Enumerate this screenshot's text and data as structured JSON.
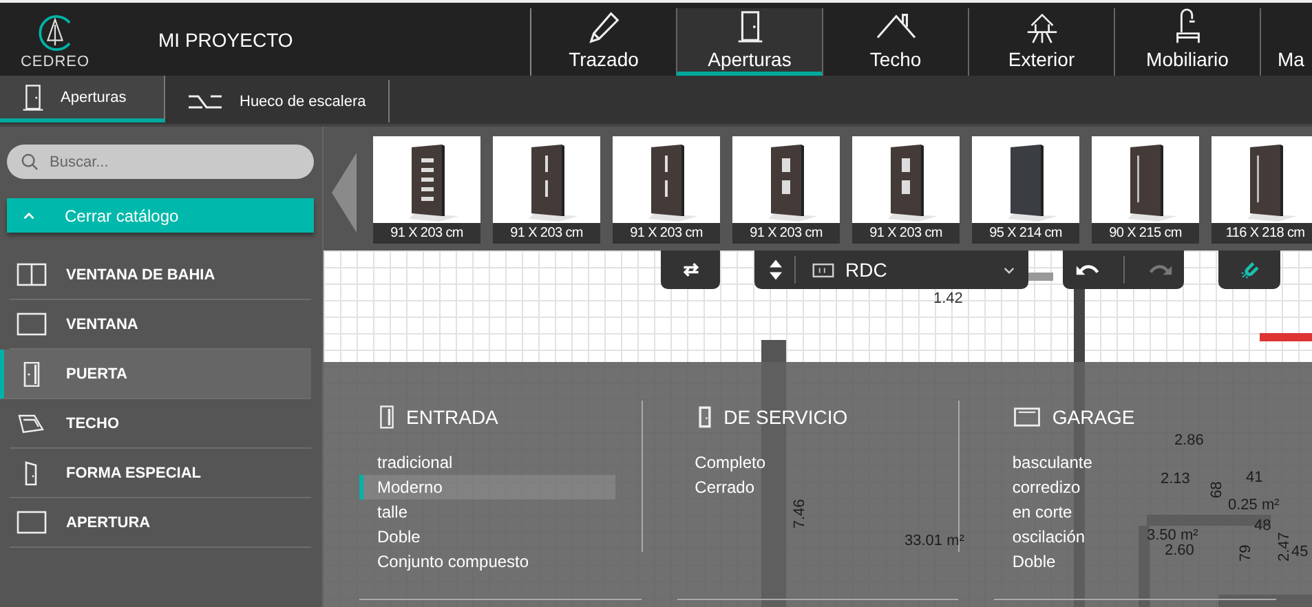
{
  "header": {
    "logo": "CEDREO",
    "project": "MI PROYECTO",
    "tabs": [
      {
        "label": "Trazado",
        "selected": false
      },
      {
        "label": "Aperturas",
        "selected": true
      },
      {
        "label": "Techo",
        "selected": false
      },
      {
        "label": "Exterior",
        "selected": false
      },
      {
        "label": "Mobiliario",
        "selected": false
      },
      {
        "label": "Ma",
        "selected": false
      }
    ]
  },
  "subtabs": [
    {
      "label": "Aperturas",
      "selected": true
    },
    {
      "label": "Hueco de escalera",
      "selected": false
    }
  ],
  "sidebar": {
    "search": {
      "placeholder": "Buscar..."
    },
    "catalog_button": "Cerrar catálogo",
    "items": [
      {
        "label": "VENTANA DE BAHIA",
        "selected": false
      },
      {
        "label": "VENTANA",
        "selected": false
      },
      {
        "label": "PUERTA",
        "selected": true
      },
      {
        "label": "TECHO",
        "selected": false
      },
      {
        "label": "FORMA ESPECIAL",
        "selected": false
      },
      {
        "label": "APERTURA",
        "selected": false
      }
    ]
  },
  "catalog": [
    {
      "size": "91 X 203 cm"
    },
    {
      "size": "91 X 203 cm"
    },
    {
      "size": "91 X 203 cm"
    },
    {
      "size": "91 X 203 cm"
    },
    {
      "size": "91 X 203 cm"
    },
    {
      "size": "95 X 214 cm"
    },
    {
      "size": "90 X 215 cm"
    },
    {
      "size": "116 X 218 cm"
    }
  ],
  "toolbar": {
    "level": "RDC"
  },
  "plan": {
    "labels": [
      "1.42",
      "7.46",
      "33.01 m²",
      "2.86",
      "2.13",
      "41",
      "68",
      "0.25 m²",
      "48",
      "3.50 m²",
      "79",
      "2.60",
      "2.47",
      "45"
    ]
  },
  "menu": {
    "columns": [
      {
        "title": "ENTRADA",
        "items": [
          {
            "label": "tradicional",
            "selected": false
          },
          {
            "label": "Moderno",
            "selected": true
          },
          {
            "label": "talle",
            "selected": false
          },
          {
            "label": "Doble",
            "selected": false
          },
          {
            "label": "Conjunto compuesto",
            "selected": false
          }
        ]
      },
      {
        "title": "DE SERVICIO",
        "items": [
          {
            "label": "Completo",
            "selected": false
          },
          {
            "label": "Cerrado",
            "selected": false
          }
        ]
      },
      {
        "title": "GARAGE",
        "items": [
          {
            "label": "basculante",
            "selected": false
          },
          {
            "label": "corredizo",
            "selected": false
          },
          {
            "label": "en corte",
            "selected": false
          },
          {
            "label": "oscilación",
            "selected": false
          },
          {
            "label": "Doble",
            "selected": false
          }
        ]
      }
    ]
  }
}
